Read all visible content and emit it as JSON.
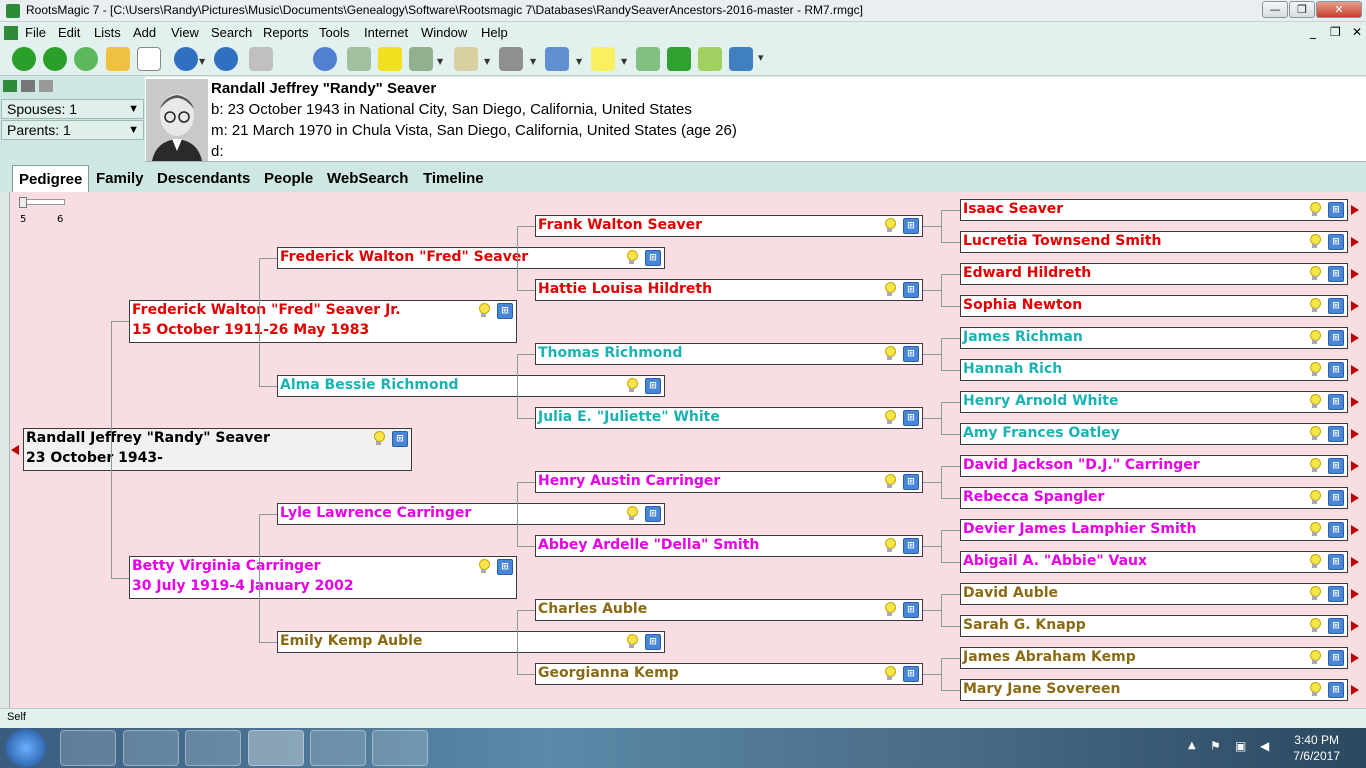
{
  "window": {
    "title": "RootsMagic 7 - [C:\\Users\\Randy\\Pictures\\Music\\Documents\\Genealogy\\Software\\Rootsmagic 7\\Databases\\RandySeaverAncestors-2016-master - RM7.rmgc]",
    "minimize": "—",
    "maximize": "❐",
    "close": "✕"
  },
  "menu": [
    "File",
    "Edit",
    "Lists",
    "Add",
    "View",
    "Search",
    "Reports",
    "Tools",
    "Internet",
    "Window",
    "Help"
  ],
  "mdi_controls": {
    "minimize": "_",
    "restore": "❐",
    "close": "✕"
  },
  "toolbar_icons": [
    "back-icon",
    "forward-icon",
    "refresh-icon",
    "open-folder-icon",
    "new-file-icon",
    "add-person-icon",
    "edit-person-icon",
    "print-icon",
    "search-icon",
    "tree-icon",
    "up-arrow-icon",
    "media-icon",
    "certificate-icon",
    "camera-icon",
    "card-icon",
    "note-icon",
    "branch-icon",
    "home-icon",
    "move-icon",
    "book-icon"
  ],
  "header": {
    "spouses": "Spouses: 1",
    "parents": "Parents: 1",
    "person_name": "Randall Jeffrey \"Randy\" Seaver",
    "birth": "b: 23 October 1943 in National City, San Diego, California, United States",
    "marriage": "m: 21 March 1970 in Chula Vista, San Diego, California, United States (age 26)",
    "death": "d:"
  },
  "tabs": [
    "Pedigree",
    "Family",
    "Descendants",
    "People",
    "WebSearch",
    "Timeline"
  ],
  "generation_slider": {
    "min_label": "5",
    "max_label": "6",
    "value": 5
  },
  "colors": {
    "paternal_paternal": "#e00000",
    "paternal_maternal": "#1ab3b3",
    "maternal_paternal": "#e600e6",
    "maternal_maternal": "#8b6a14",
    "root": "#000000",
    "canvas": "#f8dde2"
  },
  "pedigree": {
    "root": {
      "name": "Randall Jeffrey \"Randy\" Seaver",
      "dates": "23 October 1943-"
    },
    "father": {
      "name": "Frederick Walton \"Fred\" Seaver Jr.",
      "dates": "15 October 1911-26 May 1983"
    },
    "mother": {
      "name": "Betty Virginia Carringer",
      "dates": "30 July 1919-4 January 2002"
    },
    "gen3": [
      "Frederick Walton \"Fred\" Seaver",
      "Alma Bessie Richmond",
      "Lyle Lawrence Carringer",
      "Emily Kemp Auble"
    ],
    "gen4": [
      "Frank Walton Seaver",
      "Hattie Louisa Hildreth",
      "Thomas Richmond",
      "Julia E. \"Juliette\" White",
      "Henry Austin Carringer",
      "Abbey Ardelle \"Della\" Smith",
      "Charles Auble",
      "Georgianna Kemp"
    ],
    "gen5": [
      "Isaac Seaver",
      "Lucretia Townsend Smith",
      "Edward Hildreth",
      "Sophia Newton",
      "James Richman",
      "Hannah Rich",
      "Henry Arnold White",
      "Amy Frances Oatley",
      "David Jackson \"D.J.\" Carringer",
      "Rebecca Spangler",
      "Devier James Lamphier Smith",
      "Abigail A. \"Abbie\" Vaux",
      "David Auble",
      "Sarah G. Knapp",
      "James Abraham Kemp",
      "Mary Jane Sovereen"
    ]
  },
  "status": "Self",
  "taskbar": {
    "time": "3:40 PM",
    "date": "7/6/2017"
  }
}
